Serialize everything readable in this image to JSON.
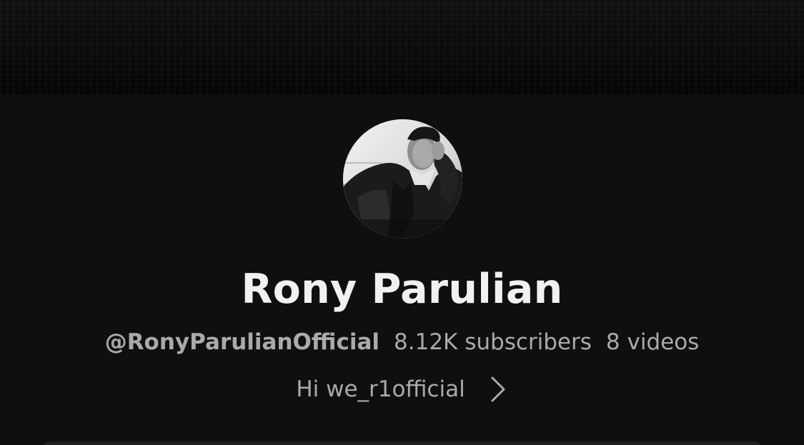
{
  "channel": {
    "name": "Rony Parulian",
    "handle": "@RonyParulianOfficial",
    "subscribers": "8.12K subscribers",
    "videos": "8 videos",
    "description": "Hi we_r1official"
  },
  "icons": {
    "avatar": "profile-photo",
    "more": "chevron-right-icon"
  },
  "colors": {
    "background": "#0f0f0f",
    "title": "#f1f1f1",
    "secondary_text": "#aaaaaa"
  }
}
